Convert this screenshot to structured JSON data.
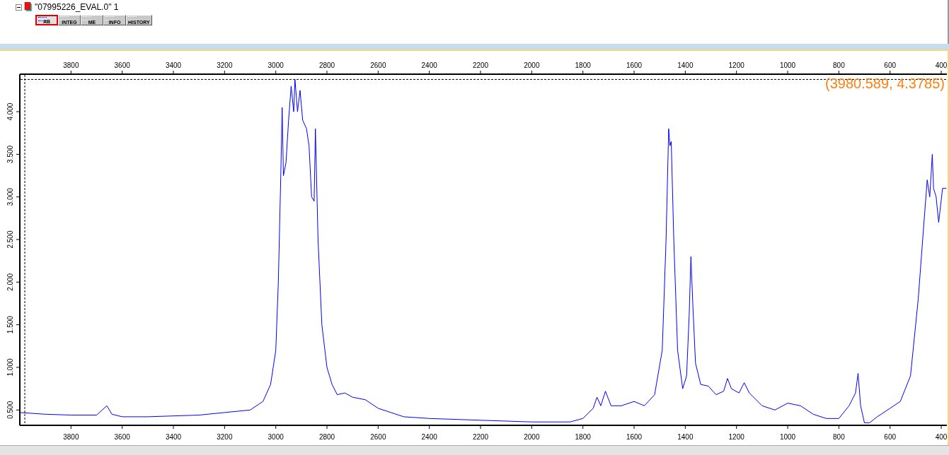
{
  "tree": {
    "expanded": true,
    "title": "\"07995226_EVAL.0\" 1"
  },
  "tabs": [
    {
      "label": "AB",
      "selected": true
    },
    {
      "label": "INTEG",
      "selected": false
    },
    {
      "label": "ME",
      "selected": false
    },
    {
      "label": "INFO",
      "selected": false
    },
    {
      "label": "HISTORY",
      "selected": false
    }
  ],
  "bottom_axis_ticks": [
    "3800",
    "3600",
    "3400",
    "3200",
    "3000",
    "2800",
    "2600",
    "2400",
    "2200",
    "2000",
    "1800",
    "1600",
    "1400",
    "1200",
    "1000",
    "800",
    "600",
    "400"
  ],
  "chart_data": {
    "type": "line",
    "xlim": [
      4000,
      378
    ],
    "ylim": [
      0.32,
      4.44
    ],
    "annotations": [
      "(3980.589, 4.3785)"
    ],
    "ref_lines": [
      {
        "axis": "x",
        "value": 3980.589
      },
      {
        "axis": "y",
        "value": 4.3785
      }
    ],
    "xticks": [
      3800,
      3600,
      3400,
      3200,
      3000,
      2800,
      2600,
      2400,
      2200,
      2000,
      1800,
      1600,
      1400,
      1200,
      1000,
      800,
      600,
      400
    ],
    "yticks": [
      {
        "value": 0.5,
        "label": "0.500"
      },
      {
        "value": 1,
        "label": "1.000"
      },
      {
        "value": 1.5,
        "label": "1.500"
      },
      {
        "value": 2,
        "label": "2.000"
      },
      {
        "value": 2.5,
        "label": "2.500"
      },
      {
        "value": 3,
        "label": "3.000"
      },
      {
        "value": 3.5,
        "label": "3.500"
      },
      {
        "value": 4,
        "label": "4.000"
      }
    ],
    "x": [
      4000,
      3900,
      3800,
      3700,
      3660,
      3640,
      3600,
      3500,
      3400,
      3300,
      3200,
      3100,
      3050,
      3020,
      3000,
      2990,
      2980,
      2975,
      2970,
      2960,
      2950,
      2940,
      2930,
      2925,
      2915,
      2905,
      2895,
      2880,
      2870,
      2860,
      2850,
      2845,
      2835,
      2820,
      2800,
      2780,
      2760,
      2730,
      2700,
      2650,
      2600,
      2500,
      2400,
      2200,
      2000,
      1850,
      1800,
      1760,
      1745,
      1730,
      1712,
      1690,
      1650,
      1600,
      1560,
      1520,
      1490,
      1475,
      1465,
      1460,
      1455,
      1445,
      1430,
      1410,
      1395,
      1385,
      1378,
      1370,
      1360,
      1340,
      1310,
      1280,
      1250,
      1235,
      1220,
      1190,
      1170,
      1150,
      1100,
      1050,
      1000,
      950,
      900,
      850,
      800,
      760,
      735,
      725,
      715,
      700,
      680,
      650,
      600,
      560,
      520,
      490,
      470,
      455,
      445,
      435,
      430,
      420,
      410,
      395,
      380
    ],
    "series": [
      {
        "color": "#0000ff",
        "values": [
          0.47,
          0.45,
          0.44,
          0.44,
          0.55,
          0.45,
          0.42,
          0.42,
          0.43,
          0.44,
          0.47,
          0.5,
          0.6,
          0.8,
          1.2,
          2.0,
          3.3,
          4.05,
          3.25,
          3.4,
          3.9,
          4.3,
          4.0,
          4.38,
          4.0,
          4.25,
          3.9,
          3.8,
          3.6,
          3.0,
          2.95,
          3.8,
          2.5,
          1.5,
          1.0,
          0.8,
          0.68,
          0.7,
          0.65,
          0.62,
          0.52,
          0.42,
          0.4,
          0.38,
          0.36,
          0.36,
          0.4,
          0.52,
          0.65,
          0.55,
          0.72,
          0.55,
          0.55,
          0.6,
          0.55,
          0.68,
          1.2,
          2.5,
          3.8,
          3.6,
          3.65,
          2.5,
          1.2,
          0.75,
          0.9,
          1.6,
          2.3,
          1.7,
          1.05,
          0.8,
          0.78,
          0.68,
          0.72,
          0.87,
          0.75,
          0.7,
          0.82,
          0.7,
          0.55,
          0.5,
          0.58,
          0.55,
          0.45,
          0.4,
          0.4,
          0.55,
          0.7,
          0.93,
          0.55,
          0.35,
          0.35,
          0.42,
          0.52,
          0.6,
          0.9,
          1.8,
          2.6,
          3.2,
          3.0,
          3.5,
          3.1,
          3.0,
          2.7,
          3.1,
          3.1
        ]
      }
    ]
  }
}
